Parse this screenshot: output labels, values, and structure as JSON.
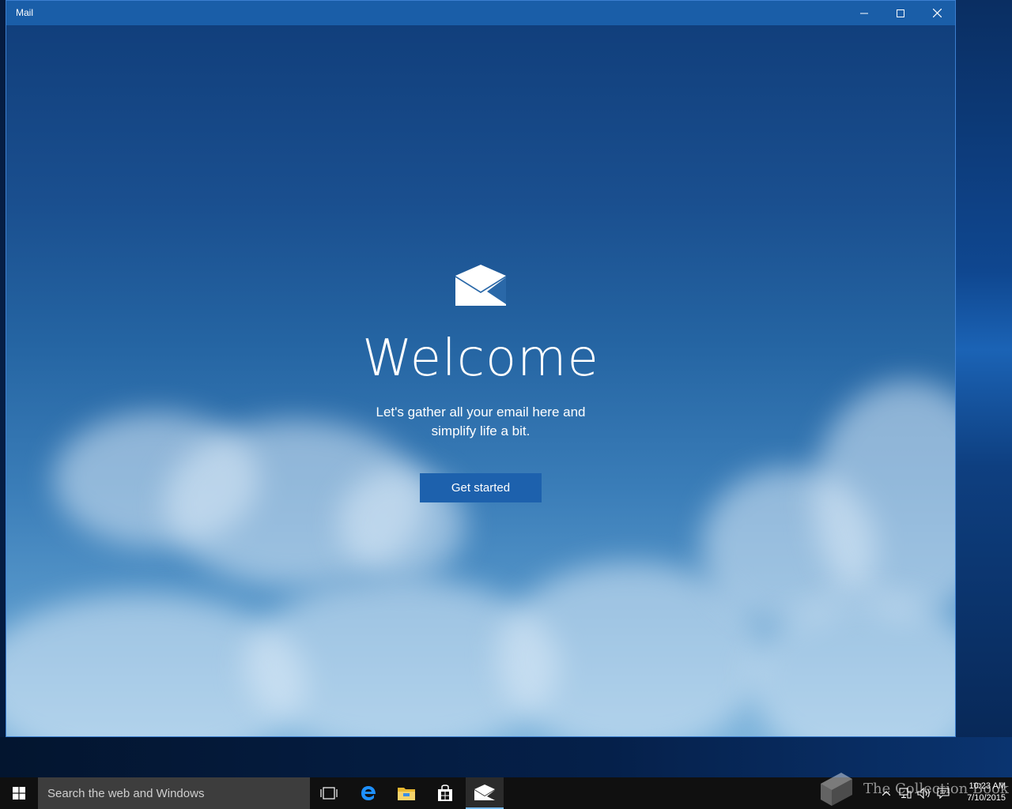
{
  "window": {
    "title": "Mail",
    "minimize_icon": "minimize-icon",
    "maximize_icon": "maximize-icon",
    "close_icon": "close-icon"
  },
  "welcome": {
    "logo_icon": "mail-envelope-icon",
    "heading": "Welcome",
    "subtitle": "Let's gather all your email here and simplify life a bit.",
    "button_label": "Get started"
  },
  "taskbar": {
    "start_icon": "windows-logo-icon",
    "search_placeholder": "Search the web and Windows",
    "pinned": [
      {
        "name": "task-view-icon"
      },
      {
        "name": "edge-icon"
      },
      {
        "name": "file-explorer-icon"
      },
      {
        "name": "store-icon"
      },
      {
        "name": "mail-icon",
        "active": true
      }
    ],
    "tray": {
      "icons": [
        "chevron-up-icon",
        "network-icon",
        "volume-icon",
        "action-center-icon"
      ],
      "time": "10:23 AM",
      "date": "7/10/2015"
    },
    "watermark": "The Collection Book"
  },
  "colors": {
    "titlebar": "#1a5ea8",
    "button": "#1d61ad",
    "taskbar": "#101010",
    "search": "#3d3d3d",
    "active_indicator": "#76b9ed"
  }
}
